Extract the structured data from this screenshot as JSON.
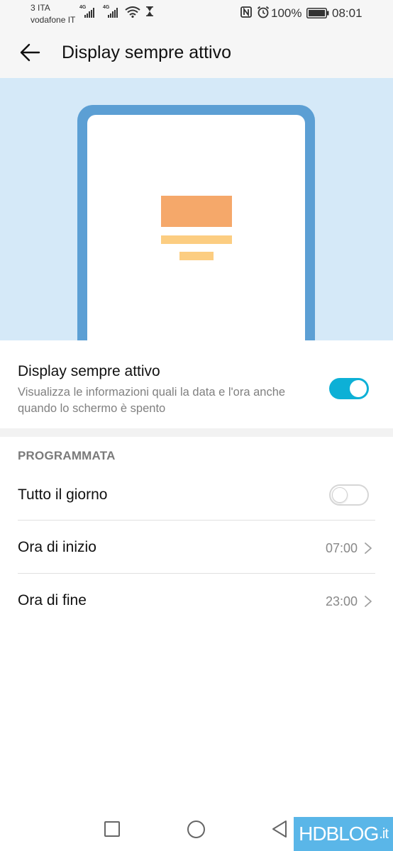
{
  "status_bar": {
    "carrier_1": "3 ITA",
    "carrier_2": "vodafone IT",
    "signal_1_tag": "4G",
    "signal_2_tag": "4G",
    "battery_percent": "100%",
    "time": "08:01",
    "icons": [
      "signal-icon",
      "signal-icon",
      "wifi-icon",
      "hourglass-icon",
      "nfc-icon",
      "alarm-icon",
      "battery-icon"
    ]
  },
  "header": {
    "back_icon": "back-arrow-icon",
    "title": "Display sempre attivo"
  },
  "illustration": {
    "frame_color": "#5c9fd4",
    "background_color": "#d5e9f8",
    "block_color": "#f5a86a",
    "line_color": "#fccd81"
  },
  "main_setting": {
    "title": "Display sempre attivo",
    "subtitle": "Visualizza le informazioni quali la data e l'ora anche quando lo schermo è spento",
    "toggle_on": true,
    "accent_color": "#0db0d6"
  },
  "schedule": {
    "section_title": "PROGRAMMATA",
    "all_day": {
      "label": "Tutto il giorno",
      "toggle_on": false
    },
    "start": {
      "label": "Ora di inizio",
      "value": "07:00"
    },
    "end": {
      "label": "Ora di fine",
      "value": "23:00"
    }
  },
  "nav_bar": {
    "icons": [
      "recent-apps-icon",
      "home-icon",
      "back-icon"
    ]
  },
  "watermark": {
    "text": "HDBLOG",
    "suffix": ".it"
  }
}
